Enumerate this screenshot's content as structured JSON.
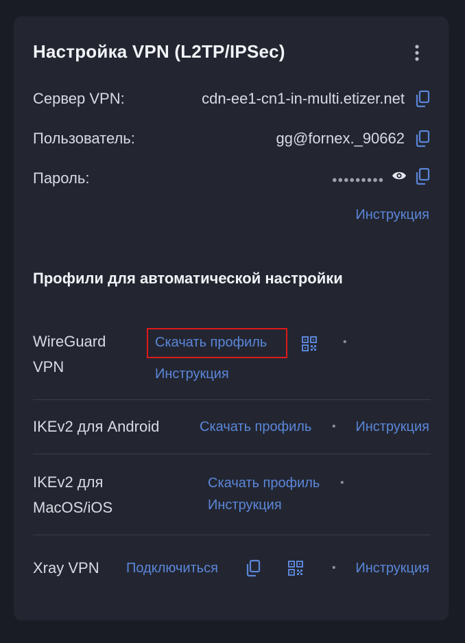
{
  "header": {
    "title": "Настройка VPN (L2TP/IPSec)",
    "menu_icon": "more-vertical-icon"
  },
  "credentials": {
    "server_label": "Сервер VPN:",
    "server_value": "cdn-ee1-cn1-in-multi.etizer.net",
    "user_label": "Пользователь:",
    "user_value": "gg@fornex._90662",
    "password_label": "Пароль:",
    "password_masked": "●●●●●●●●●",
    "instruction_link": "Инструкция",
    "icons": [
      "copy-icon",
      "eye-icon"
    ]
  },
  "profiles": {
    "heading": "Профили для автоматической настройки",
    "items": [
      {
        "name_line1": "WireGuard",
        "name_line2": "VPN",
        "download": "Скачать профиль",
        "instruction": "Инструкция",
        "highlighted": true
      },
      {
        "name": "IKEv2 для Android",
        "download": "Скачать профиль",
        "instruction": "Инструкция"
      },
      {
        "name_line1": "IKEv2 для",
        "name_line2": "MacOS/iOS",
        "download": "Скачать профиль",
        "instruction": "Инструкция"
      },
      {
        "name": "Xray VPN",
        "connect": "Подключиться",
        "instruction": "Инструкция"
      }
    ],
    "separator": "•"
  },
  "colors": {
    "background": "#1a1c25",
    "card": "#232631",
    "link": "#5b86d9",
    "highlight": "#e0191b"
  }
}
